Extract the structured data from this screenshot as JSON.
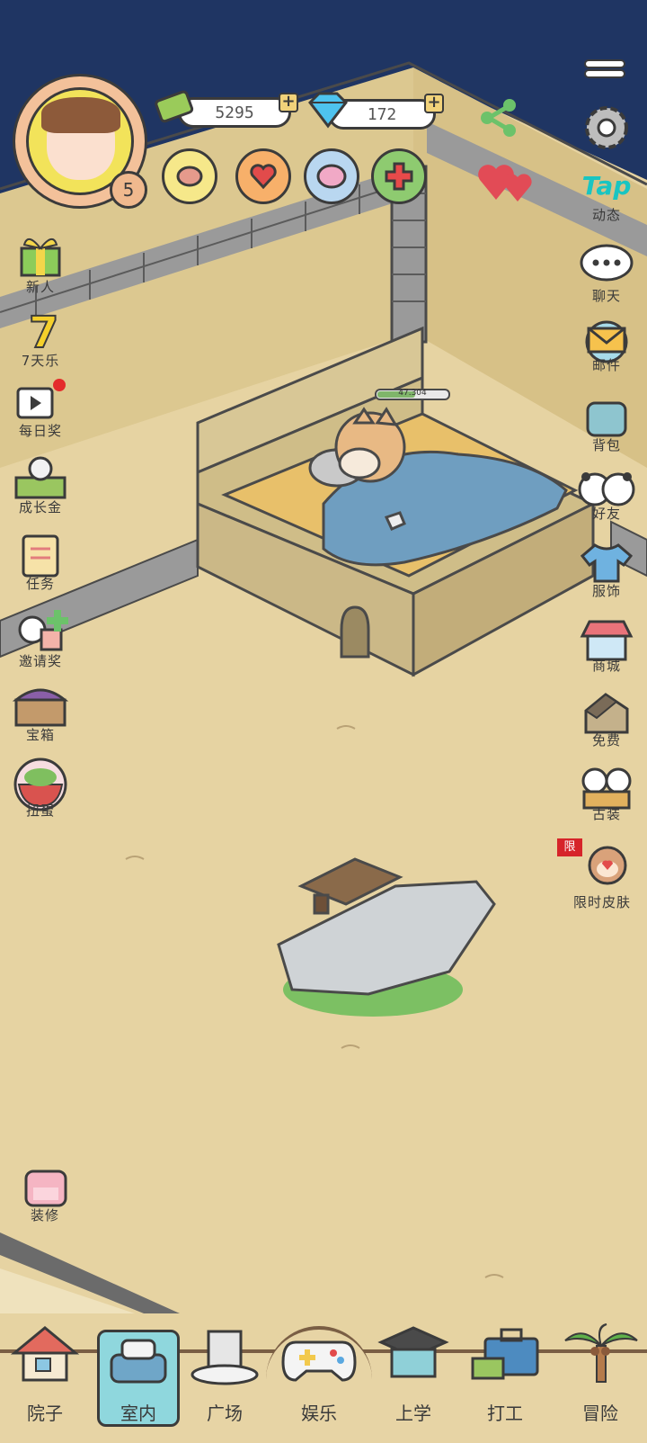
{
  "player": {
    "level": "5"
  },
  "currency": {
    "cash": "5295",
    "gems": "172"
  },
  "pet": {
    "progress": "47.304"
  },
  "left_menu": [
    {
      "key": "newbie",
      "label": "新人"
    },
    {
      "key": "seven_day",
      "label": "7天乐"
    },
    {
      "key": "daily",
      "label": "每日奖"
    },
    {
      "key": "growth",
      "label": "成长金"
    },
    {
      "key": "task",
      "label": "任务"
    },
    {
      "key": "invite",
      "label": "邀请奖"
    },
    {
      "key": "chest",
      "label": "宝箱"
    },
    {
      "key": "gacha",
      "label": "扭蛋"
    }
  ],
  "right_menu": [
    {
      "key": "tap",
      "title": "Tap",
      "label": "动态"
    },
    {
      "key": "chat",
      "label": "聊天"
    },
    {
      "key": "mail",
      "label": "邮件"
    },
    {
      "key": "bag",
      "label": "背包"
    },
    {
      "key": "friends",
      "label": "好友"
    },
    {
      "key": "clothes",
      "label": "服饰"
    },
    {
      "key": "shop",
      "label": "商城"
    },
    {
      "key": "free",
      "label": "免费"
    },
    {
      "key": "ancient",
      "label": "古装"
    },
    {
      "key": "limited_skin",
      "label": "限时皮肤",
      "badge": "限"
    }
  ],
  "decorate": {
    "label": "装修"
  },
  "bottom_nav": [
    {
      "key": "yard",
      "label": "院子"
    },
    {
      "key": "indoor",
      "label": "室内",
      "active": true
    },
    {
      "key": "plaza",
      "label": "广场"
    },
    {
      "key": "fun",
      "label": "娱乐"
    },
    {
      "key": "school",
      "label": "上学"
    },
    {
      "key": "work",
      "label": "打工"
    },
    {
      "key": "adventure",
      "label": "冒险"
    }
  ],
  "colors": {
    "floor": "#e6d3a2",
    "wall_top": "#d9c48e",
    "sky": "#1f3563",
    "active_nav": "#8fd7dd"
  }
}
